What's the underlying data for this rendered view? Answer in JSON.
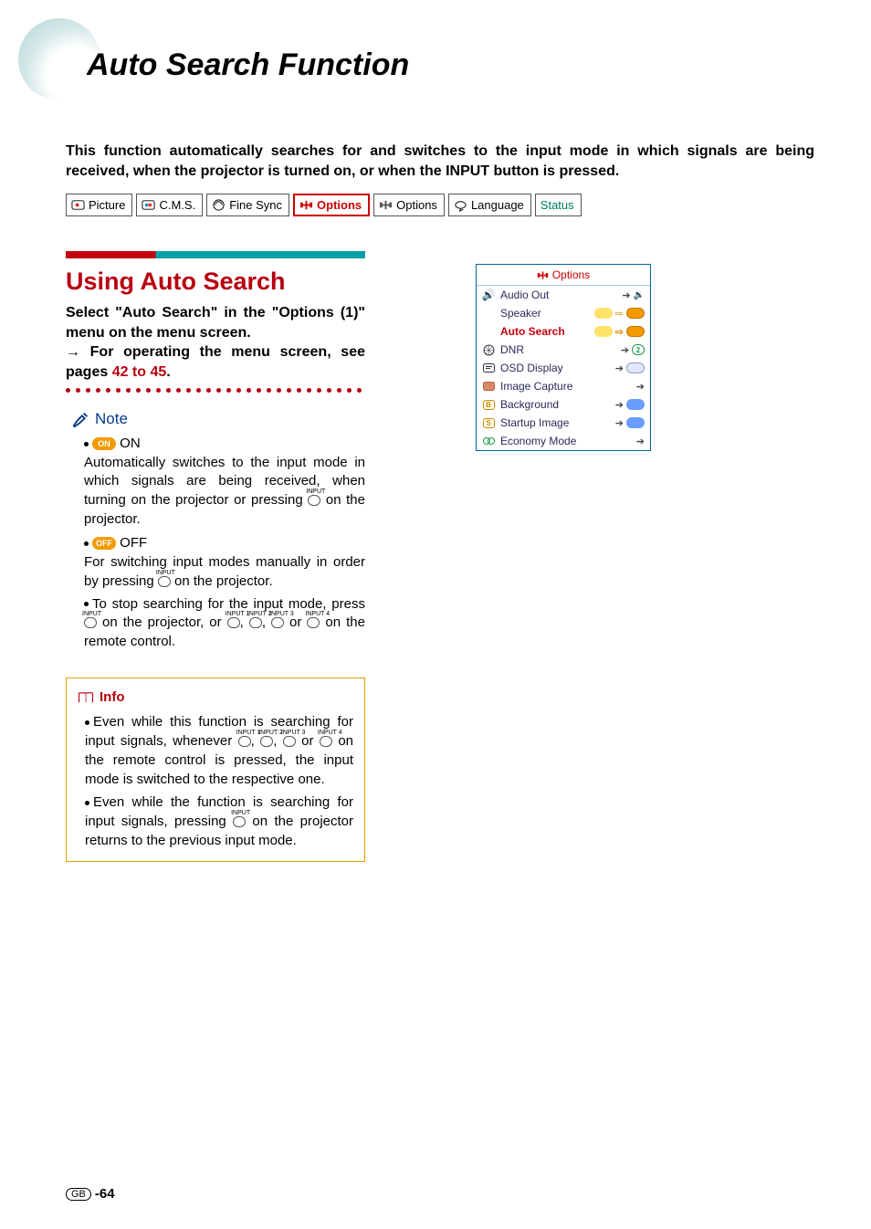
{
  "page": {
    "title": "Auto Search Function",
    "intro": "This function automatically searches for and switches to the input mode in which signals are being received, when the projector is turned on, or when the INPUT button is pressed.",
    "number": "-64",
    "region_badge": "GB"
  },
  "tabs": [
    {
      "label": "Picture",
      "selected": false
    },
    {
      "label": "C.M.S.",
      "selected": false
    },
    {
      "label": "Fine Sync",
      "selected": false
    },
    {
      "label": "Options",
      "selected": true
    },
    {
      "label": "Options",
      "selected": false
    },
    {
      "label": "Language",
      "selected": false
    },
    {
      "label": "Status",
      "selected": false,
      "status": true
    }
  ],
  "section": {
    "heading": "Using Auto Search",
    "instruction_line1": "Select \"Auto Search\" in the \"Options (1)\" menu on the menu screen.",
    "instruction_line2_prefix": "→ For operating the menu screen, see pages ",
    "instruction_line2_link": "42 to 45",
    "instruction_line2_suffix": "."
  },
  "note": {
    "label": "Note",
    "on_pill": "ON",
    "on_label": " ON",
    "on_text": "Automatically switches to the input mode in which signals are being received, when turning on the projector or pressing ",
    "on_text_tail": " on the projector.",
    "off_pill": "OFF",
    "off_label": " OFF",
    "off_text": "For switching input modes manually in order by pressing ",
    "off_text_tail": " on the projector.",
    "stop_text_a": "To stop searching for the input mode, press ",
    "stop_text_b": " on the projector, or ",
    "stop_text_c": " or ",
    "stop_text_d": " on the remote control.",
    "input_labels": [
      "INPUT 1",
      "INPUT 2",
      "INPUT 3",
      "INPUT 4"
    ],
    "input_main": "INPUT"
  },
  "info": {
    "label": "Info",
    "b1a": "Even while this function is searching for input signals, whenever ",
    "b1b": " or ",
    "b1c": " on the remote control is pressed, the input mode is switched to the respective one.",
    "b2a": "Even while the function is searching for input signals, pressing ",
    "b2b": " on the projector returns to the previous input mode."
  },
  "options_window": {
    "title": "Options",
    "rows": [
      {
        "key": "audio_out",
        "label": "Audio Out",
        "left_icon": "speaker-arrow",
        "right": "arrow+speaker"
      },
      {
        "key": "speaker",
        "label": "Speaker",
        "left_icon": "",
        "right": "pill-yellow-arrow-orange"
      },
      {
        "key": "auto_search",
        "label": "Auto Search",
        "left_icon": "",
        "right": "pill-yellow-arrow-orange",
        "hl": true
      },
      {
        "key": "dnr",
        "label": "DNR",
        "left_icon": "grid",
        "right": "arrow+circle2"
      },
      {
        "key": "osd_display",
        "label": "OSD Display",
        "left_icon": "osd",
        "right": "arrow+badge"
      },
      {
        "key": "image_capture",
        "label": "Image Capture",
        "left_icon": "capture",
        "right": "arrow"
      },
      {
        "key": "background",
        "label": "Background",
        "left_icon": "B",
        "right": "arrow+bluebadge"
      },
      {
        "key": "startup_image",
        "label": "Startup Image",
        "left_icon": "S",
        "right": "arrow+bluebadge"
      },
      {
        "key": "economy_mode",
        "label": "Economy Mode",
        "left_icon": "eco",
        "right": "arrow"
      }
    ]
  }
}
